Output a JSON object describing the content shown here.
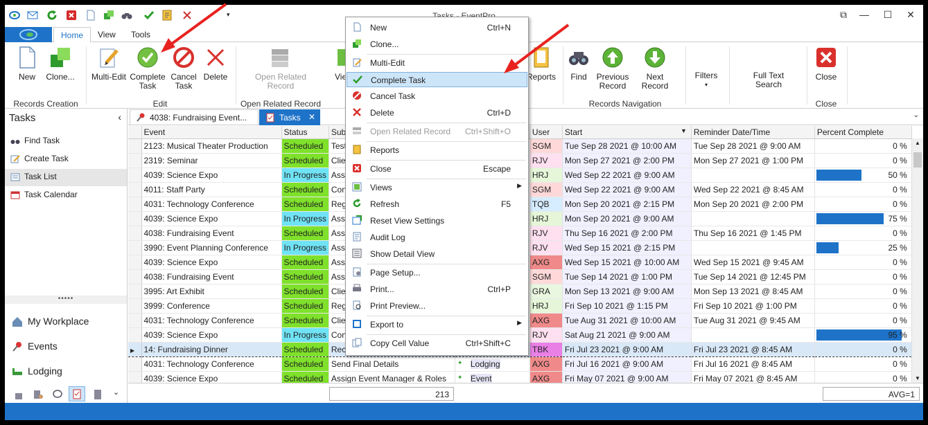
{
  "window": {
    "title": "Tasks - EventPro"
  },
  "ribbon_tabs": [
    "Home",
    "View",
    "Tools"
  ],
  "ribbon": {
    "buttons": {
      "new": "New",
      "clone": "Clone...",
      "multi_edit": "Multi-Edit",
      "complete_task": "Complete Task",
      "cancel_task": "Cancel Task",
      "delete": "Delete",
      "open_related": "Open Related Record",
      "views": "Views",
      "reports": "Reports",
      "find": "Find",
      "previous_record": "Previous Record",
      "next_record": "Next Record",
      "filters": "Filters",
      "full_text_search": "Full Text Search",
      "close": "Close"
    },
    "groups": {
      "records_creation": "Records Creation",
      "edit": "Edit",
      "open_related": "Open Related Record",
      "records_navigation": "Records Navigation",
      "close": "Close"
    }
  },
  "nav": {
    "heading": "Tasks",
    "items": [
      "Find Task",
      "Create Task",
      "Task List",
      "Task Calendar"
    ],
    "grip": "•••••",
    "big_items": [
      "My Workplace",
      "Events",
      "Lodging"
    ]
  },
  "doc_tabs": [
    "4038: Fundraising Event...",
    "Tasks"
  ],
  "grid": {
    "columns": [
      "Event",
      "Status",
      "Subj",
      "User",
      "Start",
      "Reminder Date/Time",
      "Percent Complete"
    ],
    "rows": [
      {
        "event": "2123: Musical Theater Production",
        "status": "Scheduled",
        "subj": "Test",
        "user": "SGM",
        "start": "Tue Sep 28 2021 @ 10:00 AM",
        "reminder": "Tue Sep 28 2021 @ 9:00 AM",
        "pct": "0 %",
        "pctv": 0
      },
      {
        "event": "2319: Seminar",
        "status": "Scheduled",
        "subj": "Clier",
        "user": "RJV",
        "start": "Mon Sep 27 2021 @ 2:00 PM",
        "reminder": "Mon Sep 27 2021 @ 1:00 PM",
        "pct": "0 %",
        "pctv": 0
      },
      {
        "event": "4039: Science Expo",
        "status": "In Progress",
        "subj": "Assig",
        "user": "HRJ",
        "start": "Wed Sep 22 2021 @ 9:00 AM",
        "reminder": "",
        "pct": "50 %",
        "pctv": 50
      },
      {
        "event": "4011: Staff Party",
        "status": "Scheduled",
        "subj": "Conf",
        "user": "SGM",
        "start": "Wed Sep 22 2021 @ 9:00 AM",
        "reminder": "Wed Sep 22 2021 @ 8:45 AM",
        "pct": "0 %",
        "pctv": 0
      },
      {
        "event": "4031: Technology Conference",
        "status": "Scheduled",
        "subj": "Regi",
        "user": "TQB",
        "start": "Mon Sep 20 2021 @ 2:15 PM",
        "reminder": "Mon Sep 20 2021 @ 2:00 PM",
        "pct": "0 %",
        "pctv": 0
      },
      {
        "event": "4039: Science Expo",
        "status": "In Progress",
        "subj": "Assig",
        "user": "HRJ",
        "start": "Mon Sep 20 2021 @ 9:00 AM",
        "reminder": "",
        "pct": "75 %",
        "pctv": 75
      },
      {
        "event": "4038: Fundraising Event",
        "status": "Scheduled",
        "subj": "Assig",
        "user": "RJV",
        "start": "Thu Sep 16 2021 @ 2:00 PM",
        "reminder": "Thu Sep 16 2021 @ 1:45 PM",
        "pct": "0 %",
        "pctv": 0
      },
      {
        "event": "3990: Event Planning Conference",
        "status": "In Progress",
        "subj": "Assig",
        "user": "RJV",
        "start": "Wed Sep 15 2021 @ 2:15 PM",
        "reminder": "",
        "pct": "25 %",
        "pctv": 25
      },
      {
        "event": "4039: Science Expo",
        "status": "Scheduled",
        "subj": "Assig",
        "user": "AXG",
        "start": "Wed Sep 15 2021 @ 10:00 AM",
        "reminder": "Wed Sep 15 2021 @ 9:45 AM",
        "pct": "0 %",
        "pctv": 0
      },
      {
        "event": "4038: Fundraising Event",
        "status": "Scheduled",
        "subj": "Assig",
        "user": "SGM",
        "start": "Tue Sep 14 2021 @ 1:00 PM",
        "reminder": "Tue Sep 14 2021 @ 12:45 PM",
        "pct": "0 %",
        "pctv": 0
      },
      {
        "event": "3995: Art Exhibit",
        "status": "Scheduled",
        "subj": "Clier",
        "user": "GRA",
        "start": "Mon Sep 13 2021 @ 9:00 AM",
        "reminder": "Mon Sep 13 2021 @ 8:45 AM",
        "pct": "0 %",
        "pctv": 0
      },
      {
        "event": "3999: Conference",
        "status": "Scheduled",
        "subj": "Regi",
        "user": "HRJ",
        "start": "Fri Sep 10 2021 @ 1:15 PM",
        "reminder": "Fri Sep 10 2021 @ 1:00 PM",
        "pct": "0 %",
        "pctv": 0
      },
      {
        "event": "4031: Technology Conference",
        "status": "Scheduled",
        "subj": "Clier",
        "user": "AXG",
        "start": "Tue Aug 31 2021 @ 10:00 AM",
        "reminder": "Tue Aug 31 2021 @ 9:45 AM",
        "pct": "0 %",
        "pctv": 0
      },
      {
        "event": "4039: Science Expo",
        "status": "In Progress",
        "subj": "Conf",
        "user": "RJV",
        "start": "Sat Aug 21 2021 @ 9:00 AM",
        "reminder": "",
        "pct": "95 %",
        "pctv": 95
      },
      {
        "event": "14: Fundraising Dinner",
        "status": "Scheduled",
        "subj": "Receive Payment",
        "user": "TBK",
        "start": "Fri Jul 23 2021 @ 9:00 AM",
        "reminder": "Fri Jul 23 2021 @ 8:45 AM",
        "pct": "0 %",
        "pctv": 0,
        "sel": true
      },
      {
        "event": "4031: Technology Conference",
        "status": "Scheduled",
        "subj": "Send Final Details",
        "cat": "Lodging",
        "user": "AXG",
        "start": "Fri Jul 16 2021 @ 9:00 AM",
        "reminder": "Fri Jul 16 2021 @ 8:45 AM",
        "pct": "0 %",
        "pctv": 0
      },
      {
        "event": "4039: Science Expo",
        "status": "Scheduled",
        "subj": "Assign Event Manager & Roles",
        "cat": "Event",
        "user": "AXG",
        "start": "Fri May 07 2021 @ 9:00 AM",
        "reminder": "Fri May 07 2021 @ 8:45 AM",
        "pct": "0 %",
        "pctv": 0
      }
    ],
    "footer_count": "213",
    "footer_avg": "AVG=1"
  },
  "context_menu": [
    {
      "label": "New",
      "shortcut": "Ctrl+N",
      "icon": "new-icon"
    },
    {
      "label": "Clone...",
      "shortcut": "",
      "icon": "clone-icon"
    },
    {
      "sep": true
    },
    {
      "label": "Multi-Edit",
      "shortcut": "",
      "icon": "multi-edit-icon"
    },
    {
      "label": "Complete Task",
      "shortcut": "",
      "icon": "check-icon",
      "hl": true
    },
    {
      "label": "Cancel Task",
      "shortcut": "",
      "icon": "cancel-icon"
    },
    {
      "label": "Delete",
      "shortcut": "Ctrl+D",
      "icon": "delete-icon"
    },
    {
      "sep": true
    },
    {
      "label": "Open Related Record",
      "shortcut": "Ctrl+Shift+O",
      "icon": "open-related-icon",
      "dis": true
    },
    {
      "sep": true
    },
    {
      "label": "Reports",
      "shortcut": "",
      "icon": "reports-icon"
    },
    {
      "sep": true
    },
    {
      "label": "Close",
      "shortcut": "Escape",
      "icon": "close-icon"
    },
    {
      "sep": true
    },
    {
      "label": "Views",
      "shortcut": "",
      "icon": "views-icon",
      "sub": true
    },
    {
      "label": "Refresh",
      "shortcut": "F5",
      "icon": "refresh-icon"
    },
    {
      "label": "Reset View Settings",
      "shortcut": "",
      "icon": "reset-icon"
    },
    {
      "label": "Audit Log",
      "shortcut": "",
      "icon": "audit-log-icon"
    },
    {
      "label": "Show Detail View",
      "shortcut": "",
      "icon": "detail-view-icon"
    },
    {
      "sep": true
    },
    {
      "label": "Page Setup...",
      "shortcut": "",
      "icon": "page-setup-icon"
    },
    {
      "label": "Print...",
      "shortcut": "Ctrl+P",
      "icon": "print-icon"
    },
    {
      "label": "Print Preview...",
      "shortcut": "",
      "icon": "print-preview-icon"
    },
    {
      "sep": true
    },
    {
      "label": "Export to",
      "shortcut": "",
      "icon": "export-icon",
      "sub": true
    },
    {
      "sep": true
    },
    {
      "label": "Copy Cell Value",
      "shortcut": "Ctrl+Shift+C",
      "icon": "copy-icon"
    }
  ],
  "colors": {
    "accent": "#1e73c8",
    "scheduled": "#7fe12b",
    "in_progress": "#6fe3f5",
    "arrow": "#e8231f",
    "highlight": "#cde5f9"
  }
}
